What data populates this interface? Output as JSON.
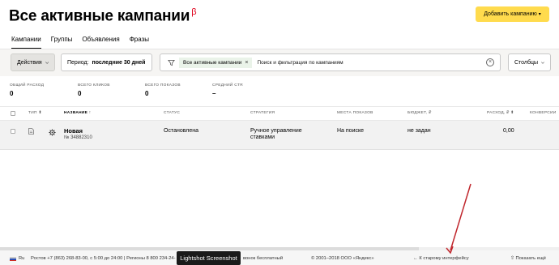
{
  "header": {
    "title": "Все активные кампании",
    "beta": "β",
    "add_button": "Добавить кампанию",
    "add_button_chevron": "▾"
  },
  "tabs": [
    {
      "label": "Кампании",
      "active": true
    },
    {
      "label": "Группы",
      "active": false
    },
    {
      "label": "Объявления",
      "active": false
    },
    {
      "label": "Фразы",
      "active": false
    }
  ],
  "toolbar": {
    "actions_label": "Действия",
    "period_prefix": "Период:",
    "period_value": "последние 30 дней",
    "filter_tag": "Все активные кампании",
    "filter_tag_close": "×",
    "filter_placeholder": "Поиск и фильтрация по кампаниям",
    "filter_clear": "×",
    "columns_label": "Столбцы"
  },
  "stats": [
    {
      "label": "ОБЩИЙ РАСХОД",
      "value": "0"
    },
    {
      "label": "ВСЕГО КЛИКОВ",
      "value": "0"
    },
    {
      "label": "ВСЕГО ПОКАЗОВ",
      "value": "0"
    },
    {
      "label": "СРЕДНИЙ CTR",
      "value": "–"
    }
  ],
  "table": {
    "columns": [
      {
        "key": "type",
        "label": "ТИП",
        "sort": "⬍"
      },
      {
        "key": "name",
        "label": "НАЗВАНИЕ",
        "sort": "↑"
      },
      {
        "key": "status",
        "label": "СТАТУС"
      },
      {
        "key": "strategy",
        "label": "СТРАТЕГИЯ"
      },
      {
        "key": "placements",
        "label": "МЕСТА ПОКАЗОВ"
      },
      {
        "key": "budget",
        "label": "БЮДЖЕТ, ₽"
      },
      {
        "key": "spend",
        "label": "РАСХОД, ₽",
        "sort": "⬍"
      },
      {
        "key": "conversions",
        "label": "КОНВЕРСИИ"
      }
    ],
    "rows": [
      {
        "name": "Новая",
        "id": "№ 34882310",
        "status": "Остановлена",
        "strategy_line1": "Ручное управление",
        "strategy_line2": "ставками",
        "placements": "На поиске",
        "budget": "не задан",
        "spend": "0,00"
      }
    ]
  },
  "footer": {
    "region": "Ru",
    "contacts": "Ростов +7 (863) 268-83-00, с 5:00 до 24:00  |  Регионы 8 800 234-24-",
    "free": "вонок бесплатный",
    "copyright": "© 2001–2018  ООО «Яндекс»",
    "old_ui_arrow": "←",
    "old_ui": "К старому интерфейсу",
    "more_arrow": "⇧",
    "more": "Показать ещё"
  },
  "tooltip": "Lightshot Screenshot",
  "colors": {
    "accent_yellow": "#ffdb4d",
    "beta_red": "#e0001b",
    "arrow_red": "#c0262c",
    "filter_tag_bg": "#eaf3e9"
  }
}
